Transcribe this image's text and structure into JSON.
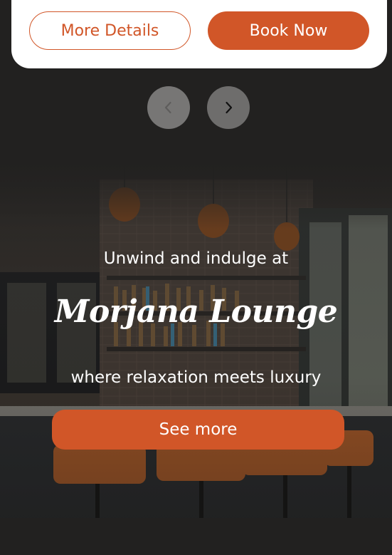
{
  "card": {
    "more_details_label": "More Details",
    "book_now_label": "Book Now"
  },
  "carousel": {
    "prev_icon": "chevron-left-icon",
    "next_icon": "chevron-right-icon"
  },
  "hero": {
    "eyebrow": "Unwind and indulge at",
    "title": "Morjana Lounge",
    "subtitle": "where relaxation meets luxury",
    "cta_label": "See more"
  },
  "colors": {
    "accent": "#d15628",
    "background": "#222120",
    "card": "#ffffff"
  }
}
